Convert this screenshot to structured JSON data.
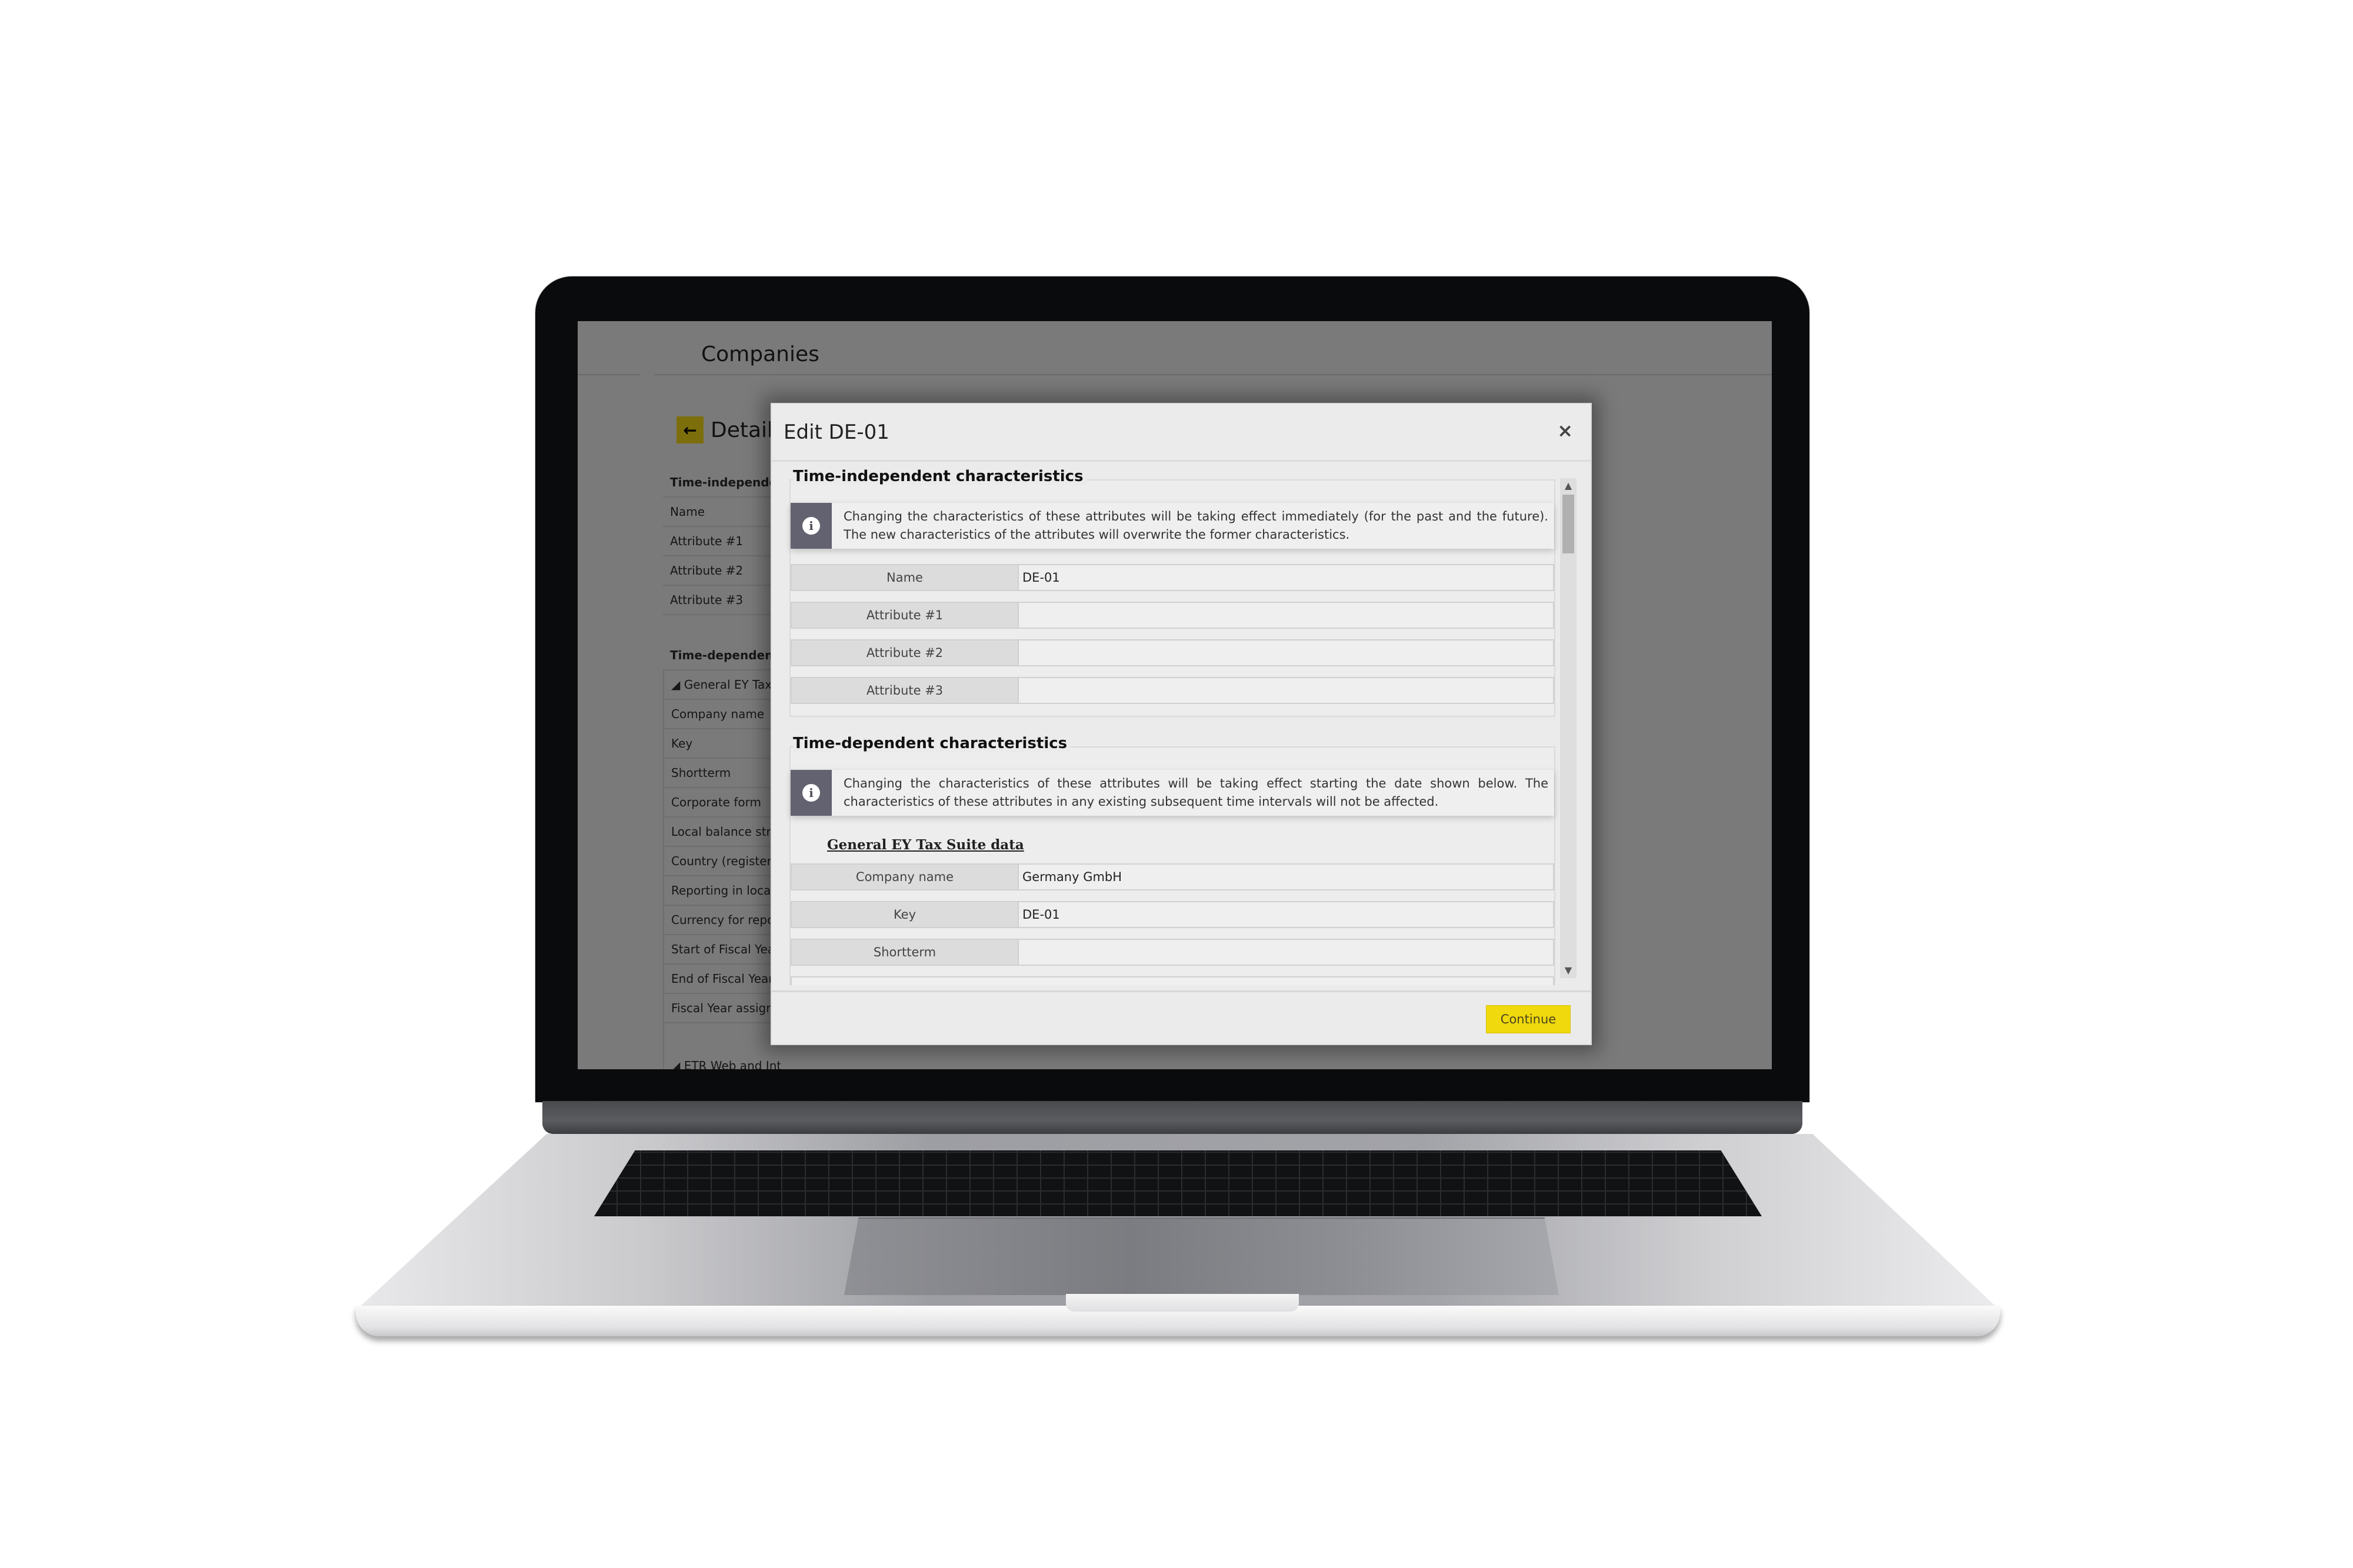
{
  "app": {
    "title": "Companies",
    "detail_title": "Details",
    "back_icon": "←"
  },
  "background_list": {
    "section1_head": "Time-independent characteristics",
    "section1_rows": [
      "Name",
      "Attribute #1",
      "Attribute #2",
      "Attribute #3"
    ],
    "section2_head": "Time-dependent characteristics",
    "group1_head": "◢ General EY Tax Suite data",
    "group1_rows": [
      "Company name",
      "Key",
      "Shortterm",
      "Corporate form",
      "Local balance structure",
      "Country (registered)",
      "Reporting in local currency",
      "Currency for reporting",
      "Start of Fiscal Year",
      "End of Fiscal Year",
      "Fiscal Year assignment"
    ],
    "group2_head": "◢ ETR Web and Interface data"
  },
  "modal": {
    "title": "Edit DE-01",
    "close_icon": "×",
    "sections": {
      "time_independent": {
        "legend": "Time-independent characteristics",
        "info": "Changing the characteristics of these attributes will be taking effect immediately (for the past and the future). The new characteristics of the attributes will overwrite the former characteristics.",
        "fields": [
          {
            "label": "Name",
            "value": ""
          },
          {
            "label": "Attribute #1",
            "value": ""
          },
          {
            "label": "Attribute #2",
            "value": ""
          },
          {
            "label": "Attribute #3",
            "value": ""
          }
        ],
        "name_value": "DE-01"
      },
      "time_dependent": {
        "legend": "Time-dependent characteristics",
        "info": "Changing the characteristics of these attributes will be taking effect starting the date shown below. The characteristics of these attributes in any existing subsequent time intervals will not be affected.",
        "group_title": "General EY Tax Suite data",
        "fields": [
          {
            "label": "Company name",
            "value": "Germany GmbH"
          },
          {
            "label": "Key",
            "value": "DE-01"
          },
          {
            "label": "Shortterm",
            "value": ""
          }
        ]
      }
    },
    "info_icon": "i",
    "scroll_up_icon": "▲",
    "scroll_down_icon": "▼",
    "scroll_position": 0.0,
    "continue_label": "Continue"
  },
  "colors": {
    "accent_yellow": "#f0d90c",
    "overlay_gray": "#7a7a7a",
    "info_icon_bg": "#636270"
  }
}
